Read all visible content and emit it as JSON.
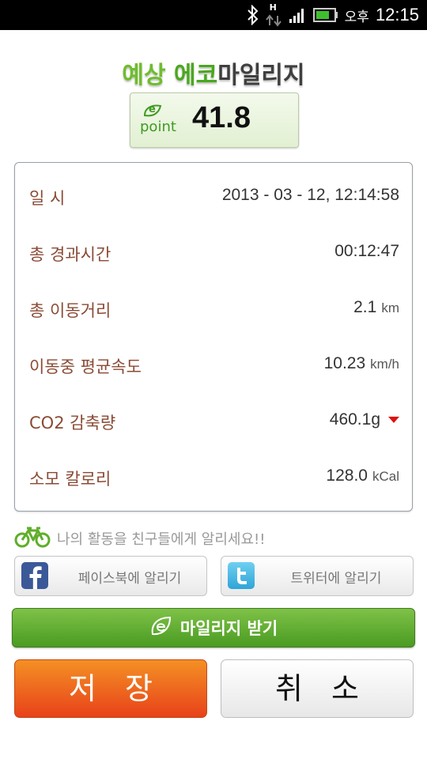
{
  "status_bar": {
    "network_label": "H",
    "ampm": "오후",
    "time": "12:15",
    "icons": [
      "bluetooth-icon",
      "data-arrows-icon",
      "signal-icon",
      "battery-icon"
    ]
  },
  "header": {
    "title_part1": "예상",
    "title_part2": "에코",
    "title_part3": "마일리지"
  },
  "point_box": {
    "logo_letter": "e",
    "logo_text": "point",
    "value": "41.8"
  },
  "info_rows": [
    {
      "label": "일 시",
      "value": "2013 - 03 - 12, 12:14:58",
      "unit": ""
    },
    {
      "label": "총 경과시간",
      "value": "00:12:47",
      "unit": ""
    },
    {
      "label": "총 이동거리",
      "value": "2.1",
      "unit": "km"
    },
    {
      "label": "이동중 평균속도",
      "value": "10.23",
      "unit": "km/h"
    },
    {
      "label": "CO2 감축량",
      "value": "460.1g",
      "unit": ""
    },
    {
      "label": "소모 칼로리",
      "value": "128.0",
      "unit": "kCal"
    }
  ],
  "share": {
    "prompt": "나의 활동을 친구들에게 알리세요!!",
    "facebook_label": "페이스북에 알리기",
    "twitter_label": "트위터에 알리기"
  },
  "mileage_button": {
    "label": "마일리지 받기"
  },
  "actions": {
    "save_label": "저장",
    "cancel_label": "취소"
  },
  "colors": {
    "accent_green": "#4a9b22",
    "save_orange": "#e8421a",
    "label_brown": "#8a4b35",
    "down_indicator": "#dd1111"
  }
}
